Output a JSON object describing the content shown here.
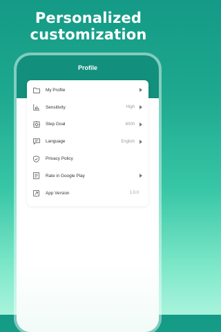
{
  "banner": {
    "title_line1": "Personalized",
    "title_line2": "customization"
  },
  "screen": {
    "title": "Profile"
  },
  "menu": [
    {
      "label": "My Profile",
      "value": "",
      "icon": "folder-icon",
      "arrow": true
    },
    {
      "label": "Sensitivity",
      "value": "High",
      "icon": "bar-chart-icon",
      "arrow": true
    },
    {
      "label": "Step Goal",
      "value": "6000",
      "icon": "target-icon",
      "arrow": true
    },
    {
      "label": "Language",
      "value": "English",
      "icon": "chat-bubble-icon",
      "arrow": true
    },
    {
      "label": "Privacy Policy",
      "value": "",
      "icon": "shield-icon",
      "arrow": false
    },
    {
      "label": "Rate in Google Play",
      "value": "",
      "icon": "document-icon",
      "arrow": true
    },
    {
      "label": "App Version",
      "value": "1.0.0",
      "icon": "version-icon",
      "arrow": false
    }
  ],
  "colors": {
    "accent": "#128f7d",
    "icon": "#555555"
  }
}
